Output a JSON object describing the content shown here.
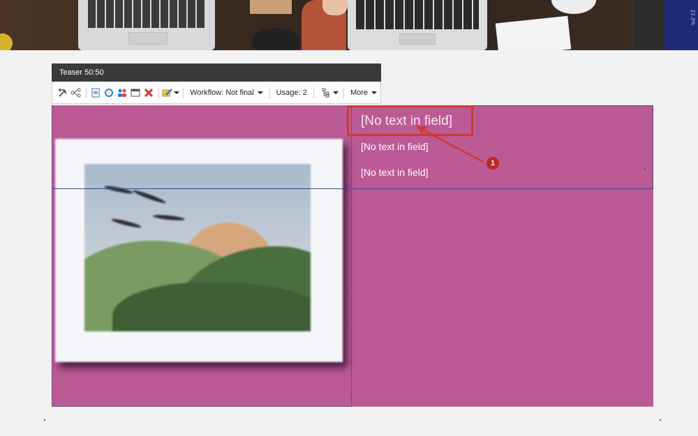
{
  "hero": {
    "side_text": "22.3%"
  },
  "toolbar": {
    "title": "Teaser 50:50",
    "workflow_label": "Workflow: Not final",
    "usage_label": "Usage: 2",
    "more_label": "More",
    "icons": [
      "tools-icon",
      "share-nodes-icon",
      "document-icon",
      "refresh-icon",
      "users-icon",
      "window-icon",
      "delete-icon",
      "edit-icon",
      "tree-icon"
    ]
  },
  "teaser": {
    "title_placeholder": "[No text in field]",
    "line1": "[No text in field]",
    "line2": "[No text in field]"
  },
  "annotation": {
    "number": "1",
    "color": "#d03a2f"
  },
  "colors": {
    "panel": "#bb5a95",
    "toolbar_header": "#3a3a3a"
  }
}
